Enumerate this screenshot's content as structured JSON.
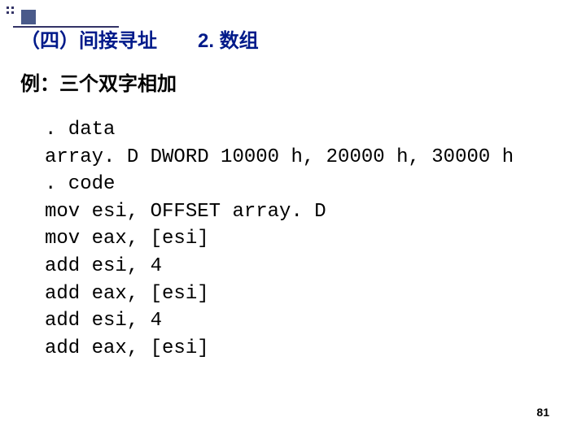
{
  "header": {
    "title_left": "（四）间接寻址",
    "title_right": "2. 数组"
  },
  "subtitle": "例：三个双字相加",
  "code": {
    "lines": [
      ". data",
      "array. D DWORD 10000 h, 20000 h, 30000 h",
      ". code",
      "mov esi, OFFSET array. D",
      "mov eax, [esi]",
      "add esi, 4",
      "add eax, [esi]",
      "add esi, 4",
      "add eax, [esi]"
    ]
  },
  "page_number": "81"
}
